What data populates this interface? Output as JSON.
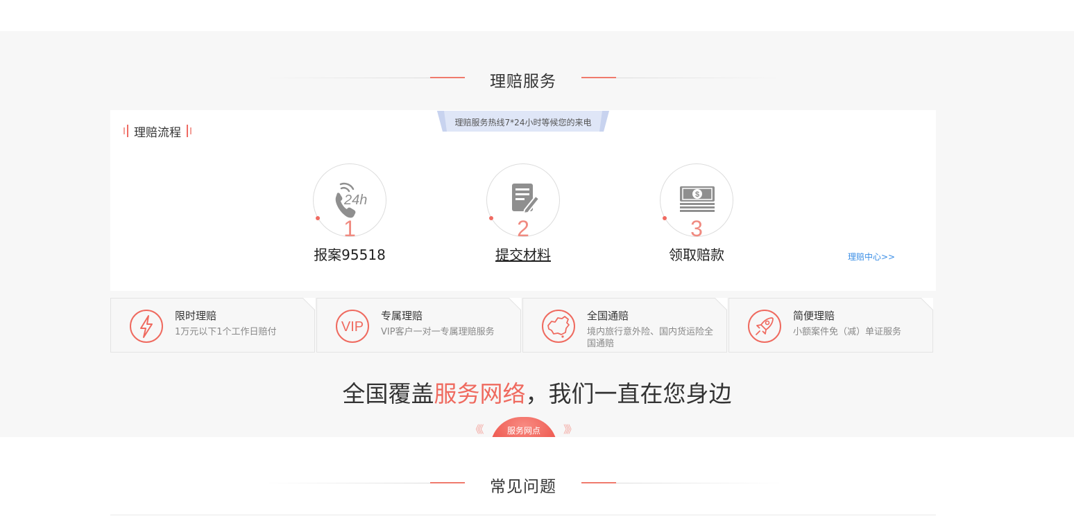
{
  "claims_section": {
    "title": "理赔服务",
    "hotline_banner": "理赔服务热线7*24小时等候您的来电",
    "process_title": "理赔流程",
    "steps": [
      {
        "number": "1",
        "label": "报案95518",
        "icon": "phone-24h-icon"
      },
      {
        "number": "2",
        "label": "提交材料",
        "icon": "document-edit-icon"
      },
      {
        "number": "3",
        "label": "领取赔款",
        "icon": "money-stack-icon"
      }
    ],
    "center_link": "理赔中心>>",
    "features": [
      {
        "title": "限时理赔",
        "desc": "1万元以下1个工作日赔付",
        "icon": "lightning-icon"
      },
      {
        "title": "专属理赔",
        "desc": "VIP客户一对一专属理赔服务",
        "icon": "vip-icon"
      },
      {
        "title": "全国通赔",
        "desc": "境内旅行意外险、国内货运险全国通赔",
        "icon": "china-map-icon"
      },
      {
        "title": "简便理赔",
        "desc": "小额案件免（减）单证服务",
        "icon": "rocket-icon"
      }
    ]
  },
  "coverage": {
    "prefix": "全国覆盖",
    "highlight": "服务网络",
    "suffix": "，我们一直在您身边",
    "outlets_button": "服务网点",
    "chevron_left": "《《",
    "chevron_right": "》》"
  },
  "faq_section": {
    "title": "常见问题"
  },
  "colors": {
    "accent": "#ef6a5f",
    "link": "#3a8ee6",
    "band": "#f7f7f7"
  }
}
